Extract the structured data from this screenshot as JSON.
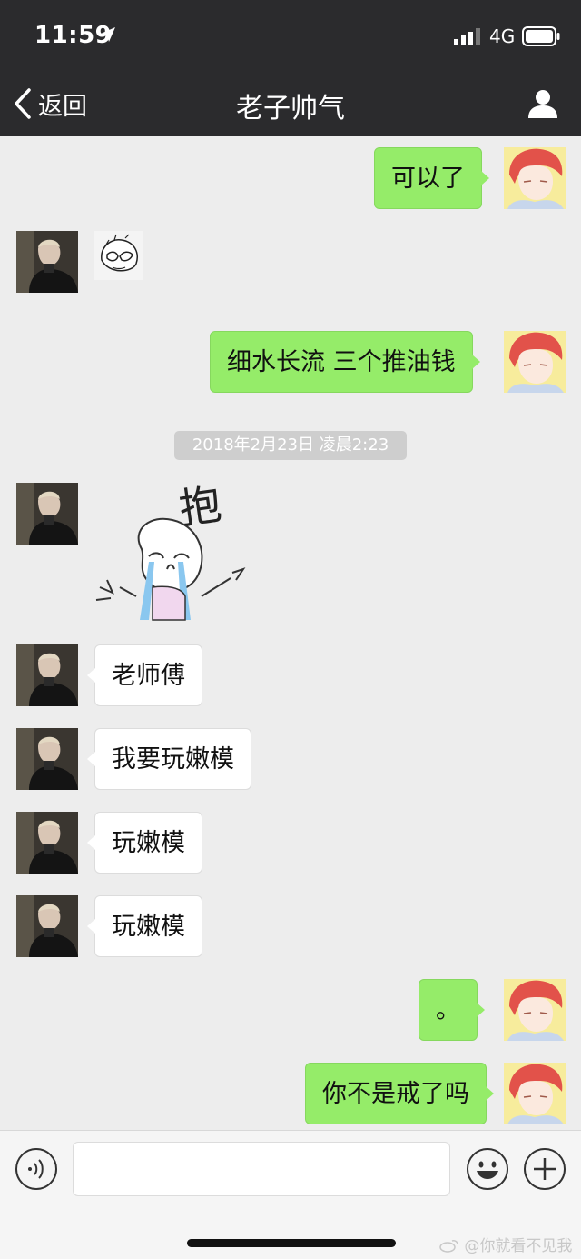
{
  "status_bar": {
    "time": "11:59",
    "network": "4G"
  },
  "nav": {
    "back_label": "返回",
    "title": "老子帅气"
  },
  "messages": [
    {
      "id": "m1",
      "side": "out",
      "type": "text",
      "text": "可以了"
    },
    {
      "id": "m2",
      "side": "in",
      "type": "sticker",
      "sticker": "covering-face-sticker"
    },
    {
      "id": "m3",
      "side": "out",
      "type": "text",
      "text": "细水长流 三个推油钱"
    },
    {
      "id": "m4",
      "side": "in",
      "type": "sticker",
      "sticker": "crying-hug-sticker",
      "sticker_text": "抱"
    },
    {
      "id": "m5",
      "side": "in",
      "type": "text",
      "text": "老师傅"
    },
    {
      "id": "m6",
      "side": "in",
      "type": "text",
      "text": "我要玩嫩模"
    },
    {
      "id": "m7",
      "side": "in",
      "type": "text",
      "text": "玩嫩模"
    },
    {
      "id": "m8",
      "side": "in",
      "type": "text",
      "text": "玩嫩模"
    },
    {
      "id": "m9",
      "side": "out",
      "type": "text",
      "text": "。"
    },
    {
      "id": "m10",
      "side": "out",
      "type": "text",
      "text": "你不是戒了吗"
    }
  ],
  "timestamp": "2018年2月23日 凌晨2:23",
  "input": {
    "value": "",
    "placeholder": ""
  },
  "watermark": "@你就看不见我",
  "icons": {
    "back": "chevron-left-icon",
    "profile": "person-icon",
    "voice": "voice-icon",
    "emoji": "smiley-icon",
    "more": "plus-icon"
  },
  "colors": {
    "header": "#2b2b2d",
    "chat_bg": "#ededed",
    "out_bubble": "#95ec69",
    "in_bubble": "#ffffff"
  }
}
